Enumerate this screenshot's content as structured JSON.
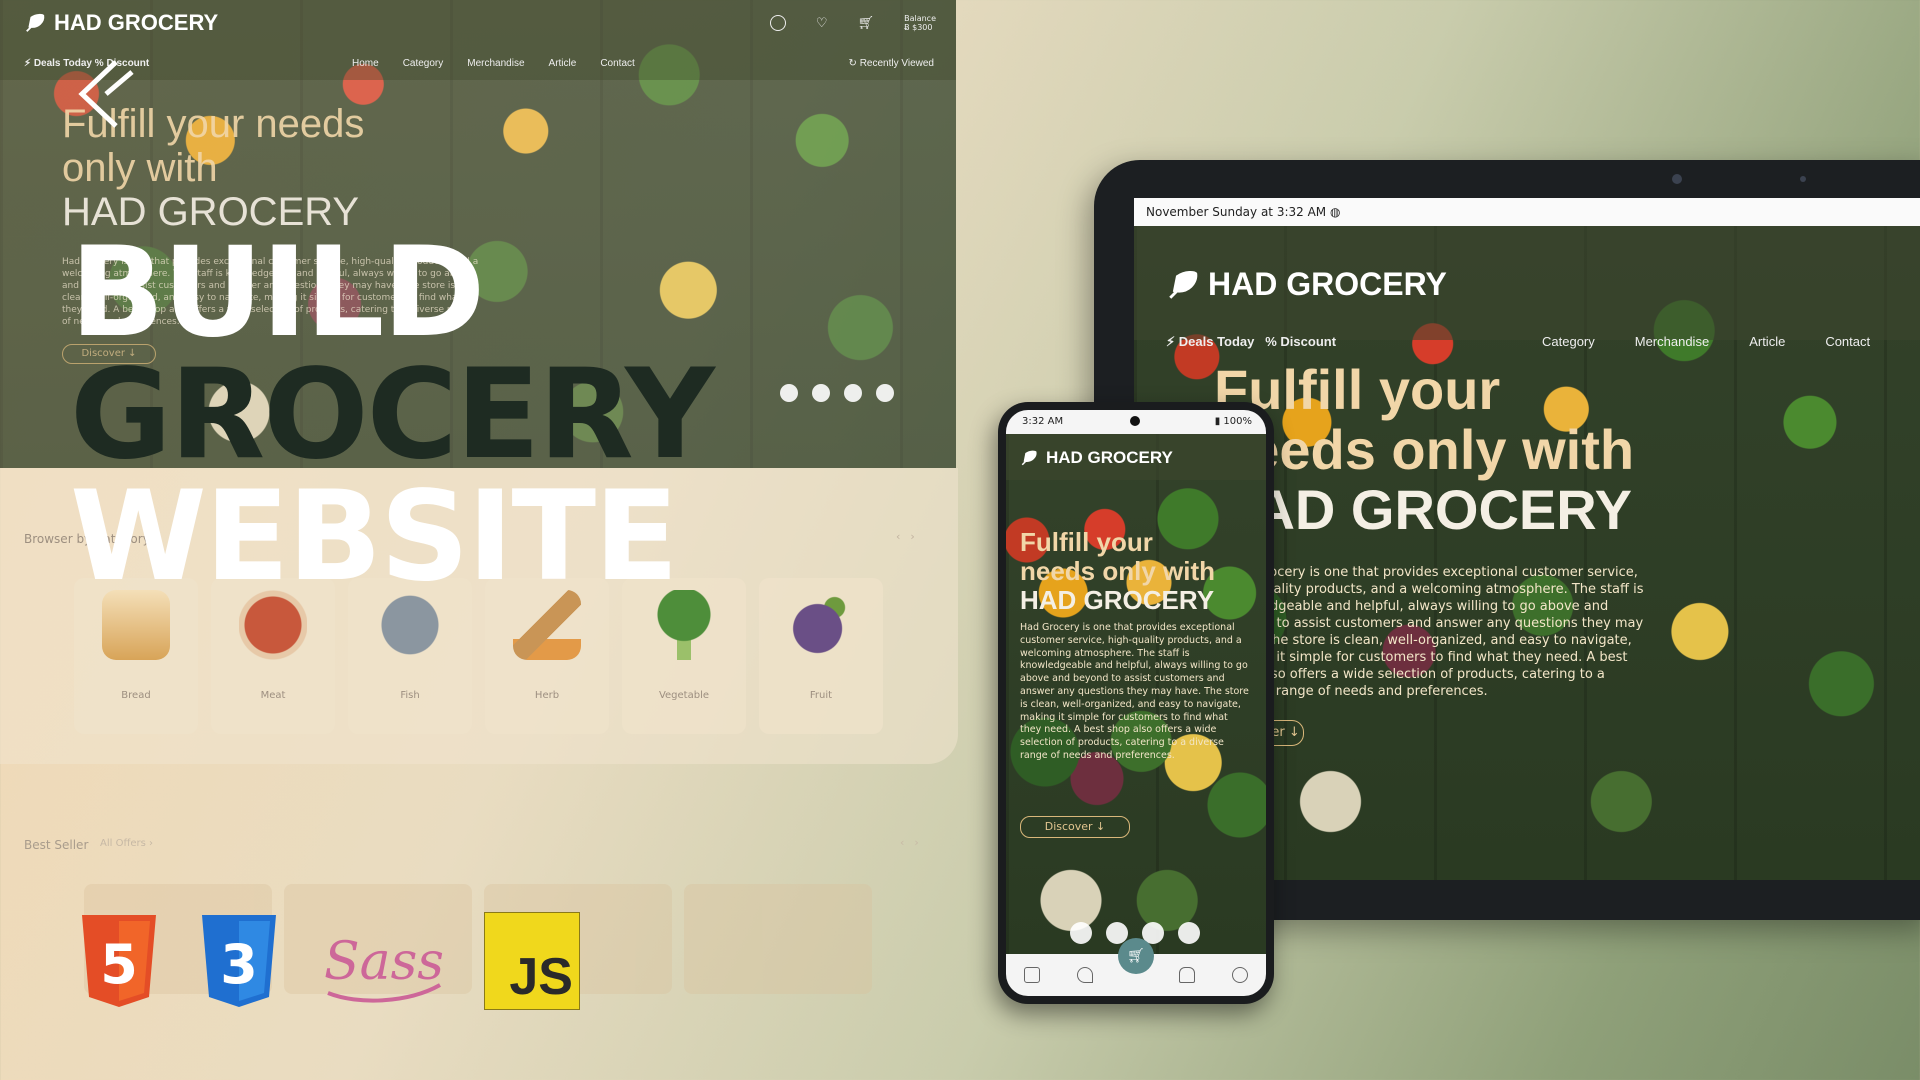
{
  "desktop": {
    "brand": "HAD GROCERY",
    "balance_label": "Balance",
    "balance_value": "Ƀ $300",
    "deals": "Deals Today",
    "discount": "Discount",
    "menu": [
      "Home",
      "Category",
      "Merchandise",
      "Article",
      "Contact"
    ],
    "recent": "Recently Viewed",
    "hero_line1": "Fulfill your needs",
    "hero_line2": "only with",
    "hero_line3": "HAD GROCERY",
    "hero_text": "Had Grocery is one that provides exceptional customer service, high-quality products, and a welcoming atmosphere. The staff is knowledgeable and helpful, always willing to go above and beyond to assist customers and answer any questions they may have. The store is clean, well-organized, and easy to navigate, making it simple for customers to find what they need. A best shop also offers a wide selection of products, catering to a diverse range of needs and preferences.",
    "discover": "Discover",
    "browse_label": "Browser by Category",
    "categories": [
      "Bread",
      "Meat",
      "Fish",
      "Herb",
      "Vegetable",
      "Fruit"
    ],
    "best_label": "Best Seller",
    "best_offers": "All Offers"
  },
  "overlay": {
    "line1": "BUILD",
    "line2": "GROCERY",
    "line3": "WEBSITE"
  },
  "tech": {
    "html_glyph": "5",
    "css_glyph": "3",
    "sass": "Sass",
    "js": "JS"
  },
  "tablet": {
    "status": "November Sunday at 3:32 AM",
    "brand": "HAD GROCERY",
    "deals": "Deals Today",
    "discount": "Discount",
    "menu": [
      "Category",
      "Merchandise",
      "Article",
      "Contact"
    ],
    "hero_line1": "Fulfill your",
    "hero_line2": "needs only with",
    "hero_line3": "HAD GROCERY",
    "hero_text": "Had Grocery is one that provides exceptional customer service, high-quality products, and a welcoming atmosphere. The staff is knowledgeable and helpful, always willing to go above and beyond to assist customers and answer any questions they may have. The store is clean, well-organized, and easy to navigate, making it simple for customers to find what they need. A best shop also offers a wide selection of products, catering to a diverse range of needs and preferences.",
    "discover": "Discover"
  },
  "phone": {
    "time": "3:32 AM",
    "battery": "100%",
    "brand": "HAD GROCERY",
    "hero_line1": "Fulfill your",
    "hero_line2": "needs only with",
    "hero_line3": "HAD GROCERY",
    "hero_text": "Had Grocery is one that provides exceptional customer service, high-quality products, and a welcoming atmosphere. The staff is knowledgeable and helpful, always willing to go above and beyond to assist customers and answer any questions they may have. The store is clean, well-organized, and easy to navigate, making it simple for customers to find what they need. A best shop also offers a wide selection of products, catering to a diverse range of needs and preferences.",
    "discover": "Discover"
  },
  "colors": {
    "accent_gold": "#f1d6a8",
    "dark_green": "#1e2b22",
    "html_orange": "#e44d26",
    "css_blue": "#1f6fd0",
    "sass_pink": "#cd6799",
    "js_yellow": "#f0d81c"
  },
  "icons": [
    "leaf-logo-icon",
    "user-icon",
    "heart-icon",
    "cart-icon",
    "facebook-icon",
    "twitter-icon",
    "instagram-icon",
    "youtube-icon",
    "home-icon",
    "bell-icon",
    "refresh-icon",
    "lightning-icon",
    "percent-icon",
    "chevron-icon"
  ]
}
